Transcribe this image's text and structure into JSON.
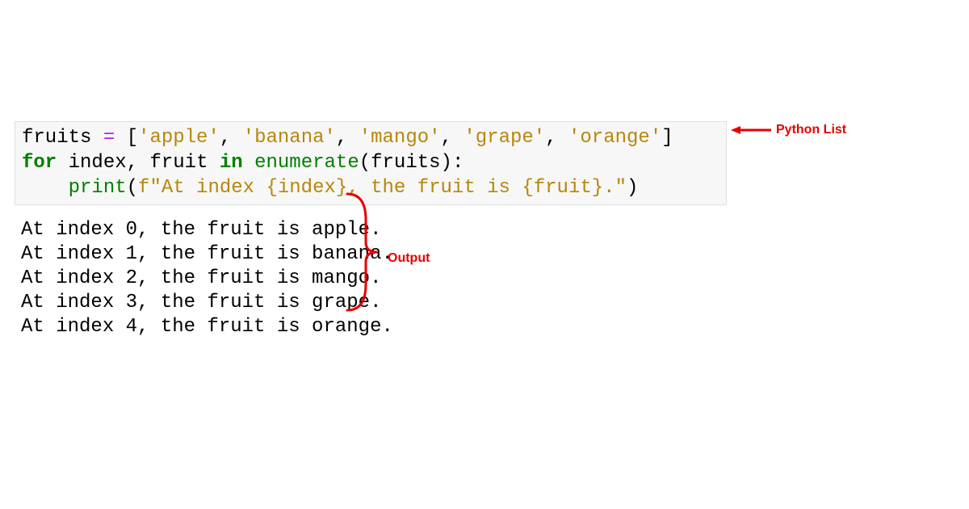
{
  "code": {
    "line1": {
      "var": "fruits",
      "eq": " = ",
      "lb": "[",
      "s1": "'apple'",
      "c1": ", ",
      "s2": "'banana'",
      "c2": ", ",
      "s3": "'mango'",
      "c3": ", ",
      "s4": "'grape'",
      "c4": ", ",
      "s5": "'orange'",
      "rb": "]"
    },
    "line2": {
      "for": "for",
      "sp1": " ",
      "idx": "index",
      "comma": ", ",
      "fruit": "fruit",
      "sp2": " ",
      "in": "in",
      "sp3": " ",
      "enum": "enumerate",
      "lp": "(",
      "arg": "fruits",
      "rp": "):"
    },
    "line3": {
      "indent": "    ",
      "print": "print",
      "lp": "(",
      "f": "f",
      "q1": "\"At index ",
      "i1": "{index}",
      "mid": ", the fruit is ",
      "i2": "{fruit}",
      "end": ".\"",
      "rp": ")"
    }
  },
  "output": {
    "l1": "At index 0, the fruit is apple.",
    "l2": "At index 1, the fruit is banana.",
    "l3": "At index 2, the fruit is mango.",
    "l4": "At index 3, the fruit is grape.",
    "l5": "At index 4, the fruit is orange."
  },
  "annotations": {
    "list_label": "Python List",
    "output_label": "Output"
  },
  "colors": {
    "annotation_red": "#e60000"
  }
}
